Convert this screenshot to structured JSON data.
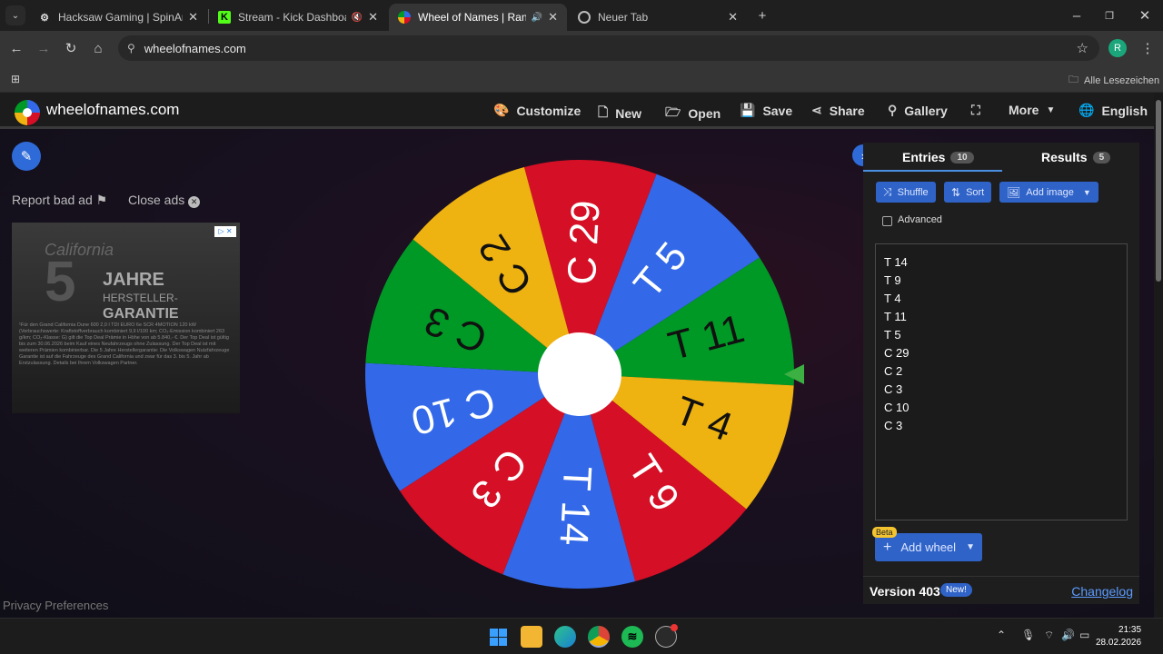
{
  "browser": {
    "tabs": [
      {
        "title": "Hacksaw Gaming | SpinArena",
        "favicon": "spinarena-icon",
        "active": false
      },
      {
        "title": "Stream - Kick Dashboard",
        "favicon": "kick-icon",
        "active": false,
        "muted": true
      },
      {
        "title": "Wheel of Names | Random",
        "favicon": "wheelofnames-icon",
        "active": true,
        "audio": true
      },
      {
        "title": "Neuer Tab",
        "favicon": "chrome-icon",
        "active": false
      }
    ],
    "url": "wheelofnames.com",
    "profile_initial": "R",
    "bookmarks_label": "Alle Lesezeichen"
  },
  "site": {
    "name": "wheelofnames.com",
    "nav": {
      "customize": "Customize",
      "new": "New",
      "open": "Open",
      "save": "Save",
      "share": "Share",
      "gallery": "Gallery",
      "more": "More",
      "language": "English"
    },
    "report_ad": "Report bad ad",
    "close_ads": "Close ads",
    "privacy": "Privacy Preferences",
    "ad": {
      "script": "California",
      "number": "5",
      "line1": "JAHRE",
      "line2": "HERSTELLER-",
      "line3": "GARANTIE",
      "fine_print": "¹Für den Grand California Dune 600 2,0 l TDI EURO 6e SCR 4MOTION 120 kW (Verbrauchswerte: Kraftstoffverbrauch kombiniert 9,9 l/100 km; CO₂-Emission kombiniert 263 g/km; CO₂-Klasse: G) gilt die Top Deal Prämie in Höhe von ab 5.840,- €. Der Top Deal ist gültig bis zum 30.06.2026 beim Kauf eines Neufahrzeugs ohne Zulassung. Der Top Deal ist mit weiteren Prämien kombinierbar. Die 5 Jahre Herstellergarantie: Die Volkswagen Nutzfahrzeuge Garantie ist auf die Fahrzeuge des Grand California und zwar für das 3. bis 5. Jahr ab Erstzulassung. Details bei Ihrem Volkswagen Partner."
    },
    "wheel": {
      "segments": [
        {
          "label": "C 29",
          "color": "#d50f25"
        },
        {
          "label": "T 5",
          "color": "#3369e8"
        },
        {
          "label": "T 11",
          "color": "#009925"
        },
        {
          "label": "T 4",
          "color": "#eeb211"
        },
        {
          "label": "T 9",
          "color": "#d50f25"
        },
        {
          "label": "T 14",
          "color": "#3369e8"
        },
        {
          "label": "C 3",
          "color": "#d50f25"
        },
        {
          "label": "C 10",
          "color": "#3369e8"
        },
        {
          "label": "C 3",
          "color": "#009925"
        },
        {
          "label": "C 2",
          "color": "#eeb211"
        }
      ],
      "pointer_color": "#3cb043"
    },
    "panel": {
      "entries_tab": "Entries",
      "entries_count": "10",
      "results_tab": "Results",
      "results_count": "5",
      "shuffle": "Shuffle",
      "sort": "Sort",
      "add_image": "Add image",
      "advanced": "Advanced",
      "entries": [
        "T 14",
        "T 9",
        "T 4",
        "T 11",
        "T 5",
        "C 29",
        "C 2",
        "C 3",
        "C 10",
        "C 3"
      ],
      "beta": "Beta",
      "add_wheel": "Add wheel",
      "version": "Version 403",
      "new_pill": "New!",
      "changelog": "Changelog"
    }
  },
  "taskbar": {
    "time": "21:35",
    "date": "28.02.2026",
    "apps": [
      "windows-start-icon",
      "file-explorer-icon",
      "edge-icon",
      "chrome-icon",
      "spotify-icon",
      "steam-icon"
    ]
  },
  "colors": {
    "accent": "#2f63c8",
    "link": "#5b9bff"
  }
}
